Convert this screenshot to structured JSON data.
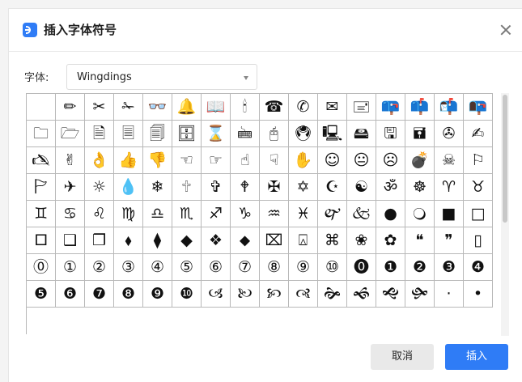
{
  "dialog": {
    "title": "插入字体符号",
    "font_label": "字体:",
    "font_value": "Wingdings",
    "cancel_label": "取消",
    "insert_label": "插入"
  },
  "symbols": [
    "",
    "✏",
    "✂",
    "✁",
    "👓",
    "🔔",
    "📖",
    "🕯",
    "☎",
    "✆",
    "✉",
    "🖃",
    "📪",
    "📫",
    "📬",
    "📭",
    "🗀",
    "🗁",
    "🗎",
    "🗏",
    "🗐",
    "🗄",
    "⌛",
    "🖮",
    "🖰",
    "🖲",
    "🖳",
    "🖴",
    "🖫",
    "🖬",
    "✇",
    "✍",
    "🖎",
    "✌",
    "👌",
    "👍",
    "👎",
    "☜",
    "☞",
    "☝",
    "☟",
    "✋",
    "☺",
    "😐",
    "☹",
    "💣",
    "☠",
    "⚐",
    "🏱",
    "✈",
    "☼",
    "💧",
    "❄",
    "🕆",
    "✞",
    "🕈",
    "✠",
    "✡",
    "☪",
    "☯",
    "ॐ",
    "☸",
    "♈",
    "♉",
    "♊",
    "♋",
    "♌",
    "♍",
    "♎",
    "♏",
    "♐",
    "♑",
    "♒",
    "♓",
    "🙰",
    "🙵",
    "●",
    "🔾",
    "■",
    "□",
    "🞐",
    "❑",
    "❒",
    "⬧",
    "⧫",
    "◆",
    "❖",
    "⬥",
    "⌧",
    "⍓",
    "⌘",
    "❀",
    "✿",
    "❝",
    "❞",
    "▯",
    "⓪",
    "①",
    "②",
    "③",
    "④",
    "⑤",
    "⑥",
    "⑦",
    "⑧",
    "⑨",
    "⑩",
    "⓿",
    "❶",
    "❷",
    "❸",
    "❹",
    "❺",
    "❻",
    "❼",
    "❽",
    "❾",
    "❿",
    "🙢",
    "🙠",
    "🙡",
    "🙣",
    "🙞",
    "🙜",
    "🙝",
    "🙟",
    "·",
    "•"
  ],
  "colors": {
    "accent": "#2f7cf6",
    "grid_line": "#b8b8b8",
    "cancel_bg": "#e9e9e9"
  },
  "icons": {
    "app": "wps-app-icon",
    "close": "close-icon",
    "dropdown": "chevron-down-icon"
  }
}
